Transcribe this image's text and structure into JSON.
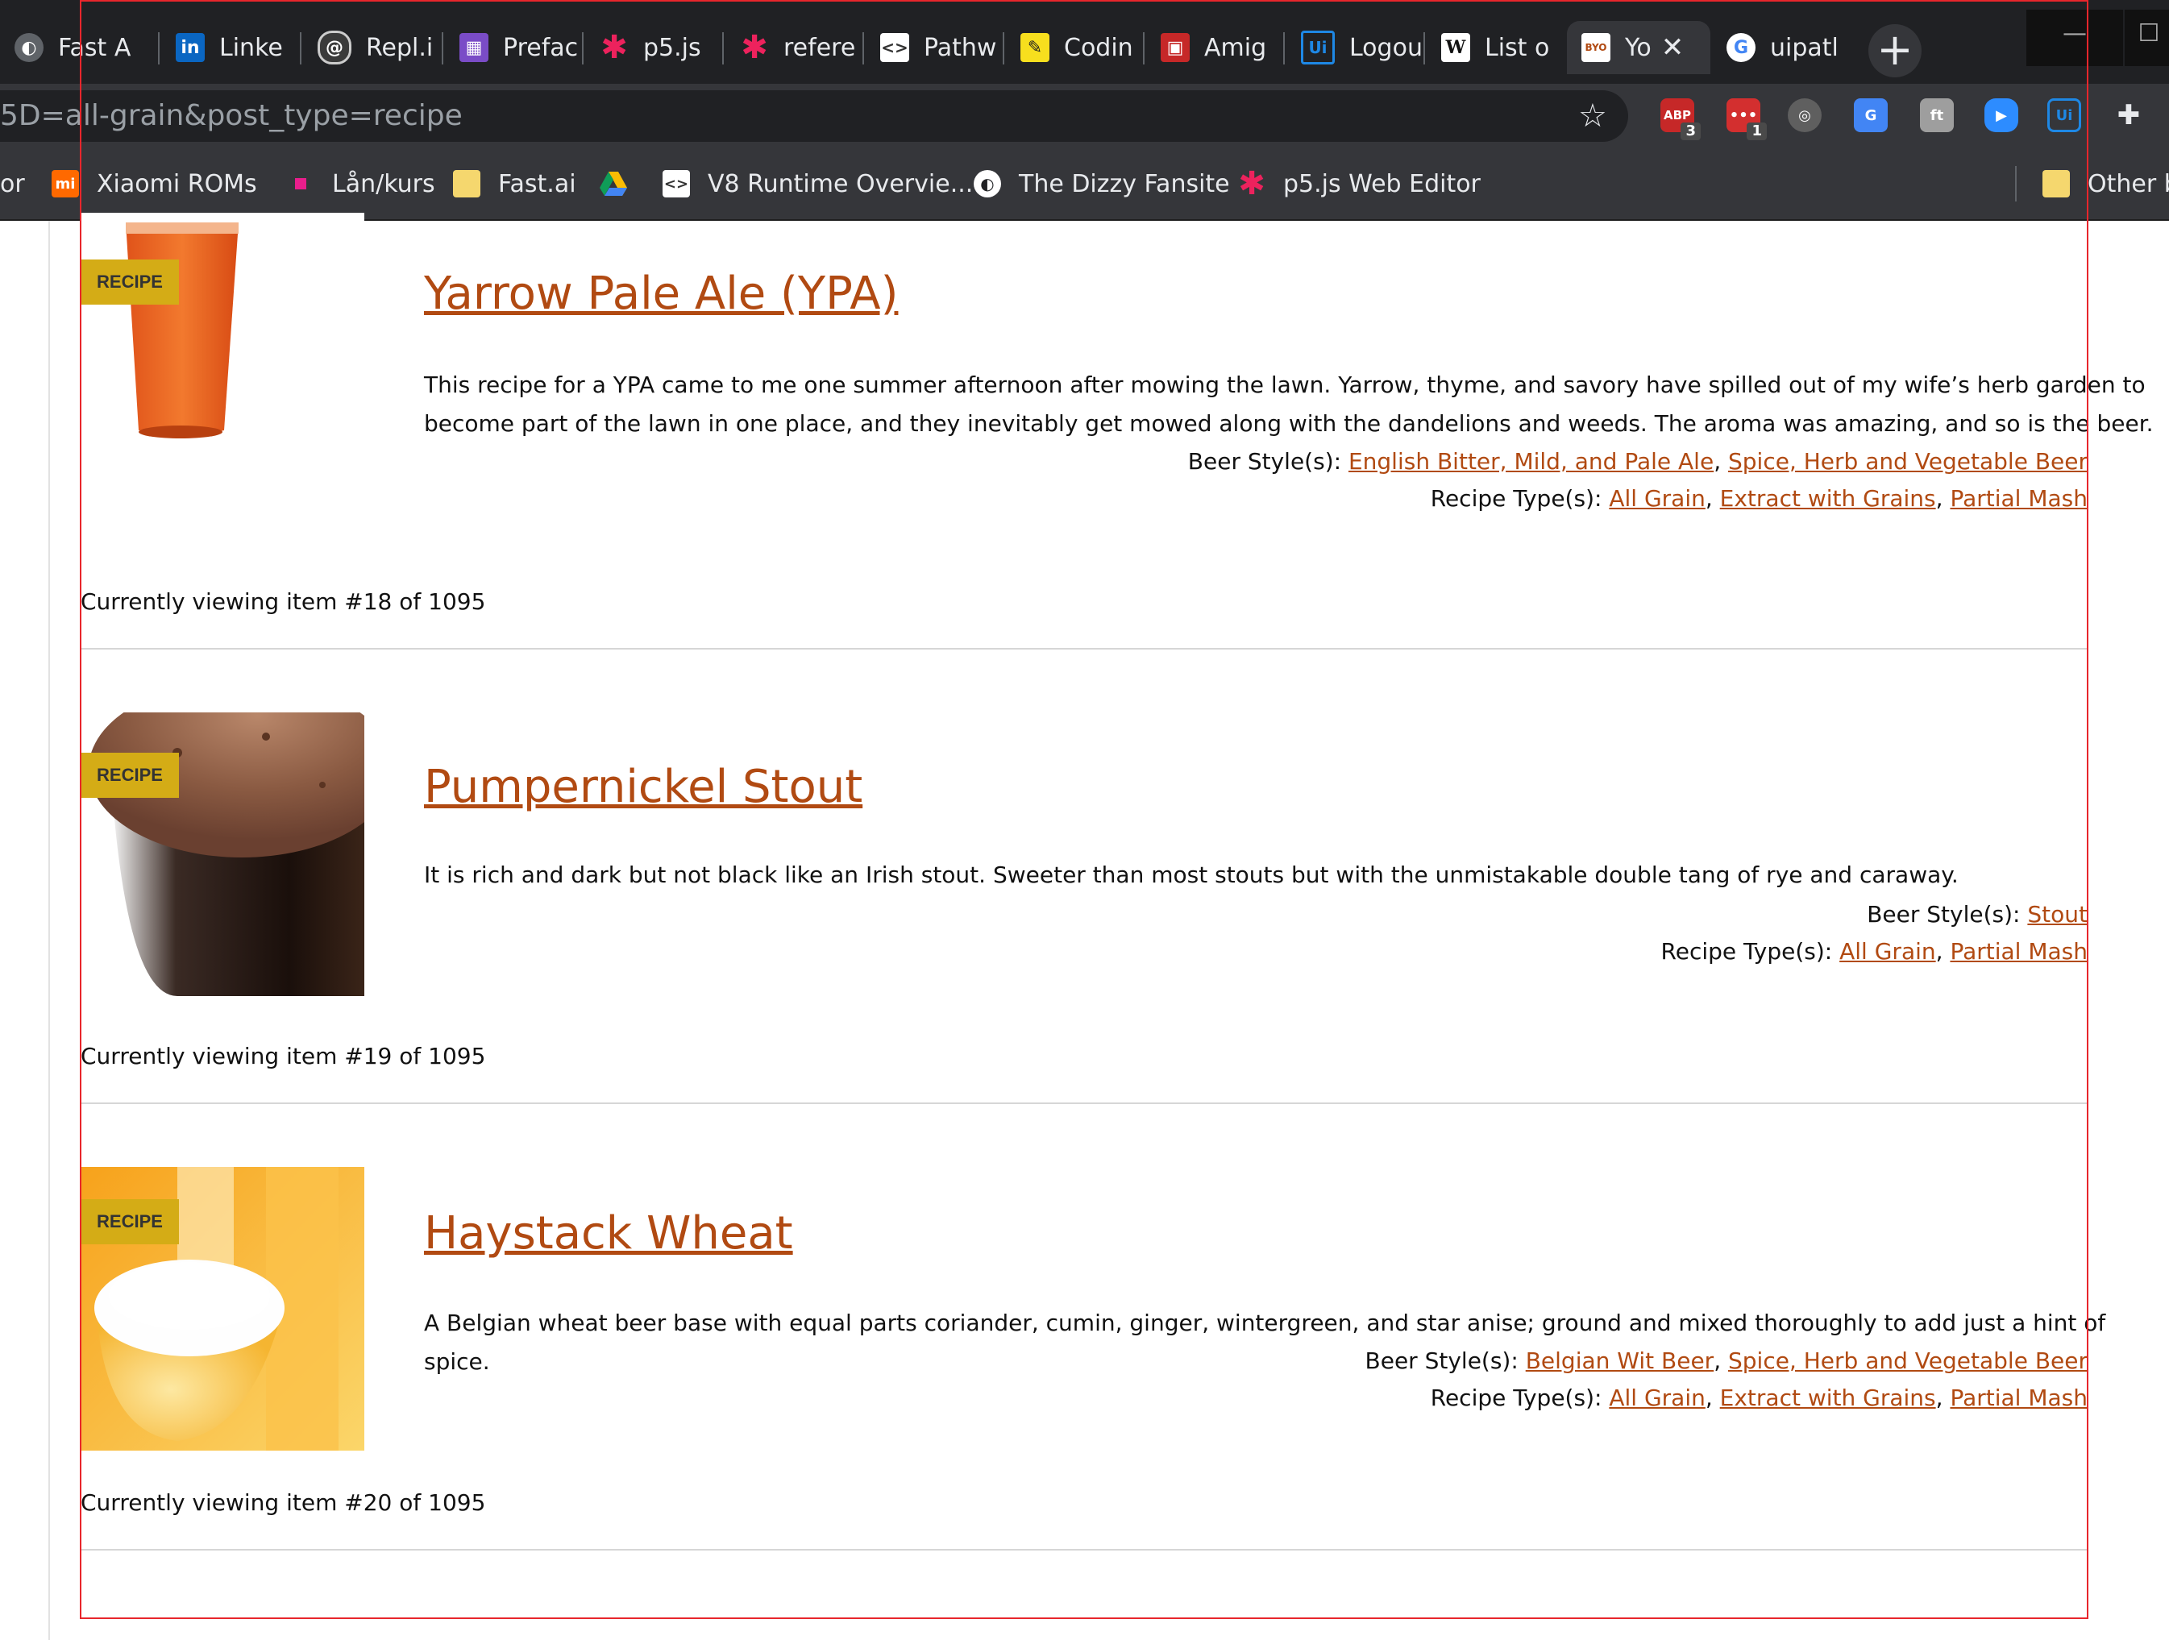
{
  "tabs": [
    {
      "title": "Fast A",
      "icon": "globe-icon"
    },
    {
      "title": "Linke",
      "icon": "linkedin-icon"
    },
    {
      "title": "Repl.i",
      "icon": "replit-icon"
    },
    {
      "title": "Prefac",
      "icon": "preface-icon"
    },
    {
      "title": "p5.js ",
      "icon": "p5js-icon"
    },
    {
      "title": "refere",
      "icon": "p5js-icon"
    },
    {
      "title": "Pathw",
      "icon": "code-icon"
    },
    {
      "title": "Codin",
      "icon": "pencil-icon"
    },
    {
      "title": "Amig",
      "icon": "floppy-icon"
    },
    {
      "title": "Logou",
      "icon": "uipath-icon"
    },
    {
      "title": "List o",
      "icon": "wikipedia-icon"
    },
    {
      "title": "Yo",
      "icon": "brewing-icon"
    },
    {
      "title": "uipatl",
      "icon": "google-icon"
    }
  ],
  "address_bar": {
    "url": "5D=all-grain&post_type=recipe"
  },
  "extensions": [
    {
      "name": "adblock-plus-icon",
      "badge": "3",
      "label": "ABP"
    },
    {
      "name": "chat-extension-icon",
      "badge": "1",
      "label": "•••"
    },
    {
      "name": "film-reel-icon",
      "badge": "",
      "label": "◎"
    },
    {
      "name": "google-translate-icon",
      "badge": "",
      "label": "G"
    },
    {
      "name": "font-icon",
      "badge": "",
      "label": "ft"
    },
    {
      "name": "zoom-icon",
      "badge": "",
      "label": "▶"
    },
    {
      "name": "uipath-icon",
      "badge": "",
      "label": "Ui"
    },
    {
      "name": "puzzle-icon",
      "badge": "",
      "label": "✚"
    }
  ],
  "bookmarks": [
    {
      "label": "or",
      "icon": ""
    },
    {
      "label": "Xiaomi ROMs",
      "icon": "xiaomi-icon"
    },
    {
      "label": "Lån/kurs",
      "icon": "pink-square-icon"
    },
    {
      "label": "Fast.ai",
      "icon": "folder-icon"
    },
    {
      "label": "",
      "icon": "google-drive-icon"
    },
    {
      "label": "V8 Runtime Overvie...",
      "icon": "code-icon"
    },
    {
      "label": "The Dizzy Fansite",
      "icon": "globe-icon"
    },
    {
      "label": "p5.js Web Editor",
      "icon": "p5js-icon"
    },
    {
      "label": "Other b",
      "icon": "folder-icon"
    }
  ],
  "recipes": [
    {
      "badge": "RECIPE",
      "title": "Yarrow Pale Ale (YPA)",
      "description": "This recipe for a YPA came to me one summer afternoon after mowing the lawn. Yarrow, thyme, and savory have spilled out of my wife’s herb garden to become part of the lawn in one place, and they inevitably get mowed along with the dandelions and weeds.  The aroma was amazing, and so is the beer.",
      "beer_styles_label": "Beer Style(s):",
      "beer_styles": [
        "English Bitter, Mild, and Pale Ale",
        "Spice, Herb and Vegetable Beer"
      ],
      "recipe_types_label": "Recipe Type(s):",
      "recipe_types": [
        "All Grain",
        "Extract with Grains",
        "Partial Mash"
      ],
      "viewing": "Currently viewing item #18 of 1095"
    },
    {
      "badge": "RECIPE",
      "title": "Pumpernickel Stout",
      "description": "It is rich and dark but not black like an Irish stout. Sweeter than most stouts but with the unmistakable double tang of rye and caraway.",
      "beer_styles_label": "Beer Style(s):",
      "beer_styles": [
        "Stout"
      ],
      "recipe_types_label": "Recipe Type(s):",
      "recipe_types": [
        "All Grain",
        "Partial Mash"
      ],
      "viewing": "Currently viewing item #19 of 1095"
    },
    {
      "badge": "RECIPE",
      "title": "Haystack Wheat",
      "description": "A Belgian wheat beer base with equal parts coriander, cumin, ginger, wintergreen, and star anise; ground and mixed thoroughly to add just a hint of spice.",
      "beer_styles_label": "Beer Style(s):",
      "beer_styles": [
        "Belgian Wit Beer",
        "Spice, Herb and Vegetable Beer"
      ],
      "recipe_types_label": "Recipe Type(s):",
      "recipe_types": [
        "All Grain",
        "Extract with Grains",
        "Partial Mash"
      ],
      "viewing": "Currently viewing item #20 of 1095"
    }
  ],
  "colors": {
    "link": "#b14a12",
    "badge": "#d4ac16",
    "chrome_dark": "#202124",
    "chrome_toolbar": "#35363a"
  }
}
